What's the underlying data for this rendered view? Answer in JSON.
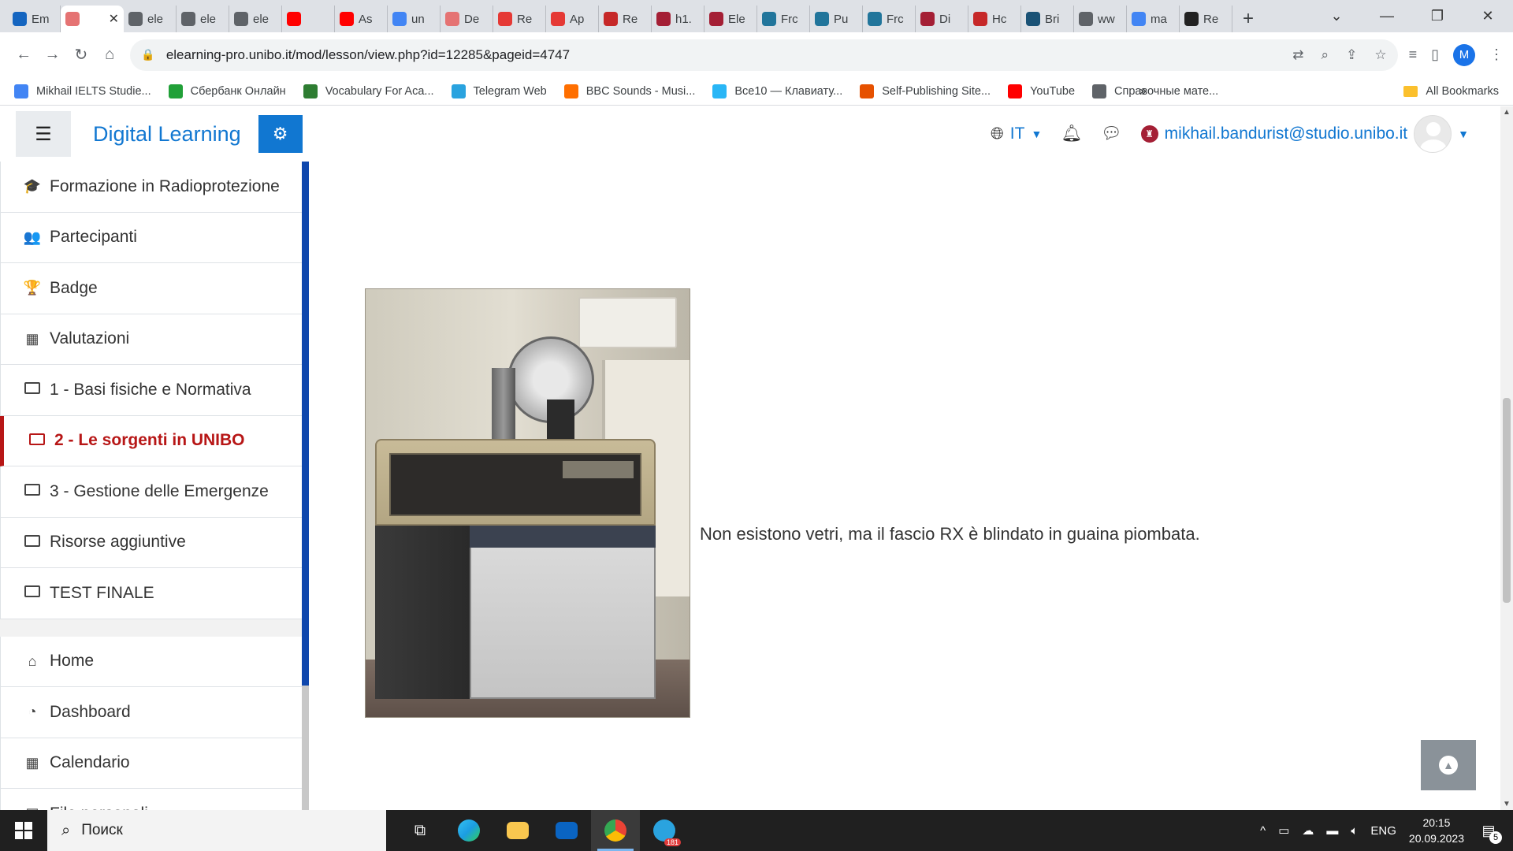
{
  "browser": {
    "tabs": [
      {
        "label": "Em",
        "color": "#1565c0"
      },
      {
        "label": "",
        "color": "#e57373",
        "active": true
      },
      {
        "label": "ele",
        "color": "#5f6368"
      },
      {
        "label": "ele",
        "color": "#5f6368"
      },
      {
        "label": "ele",
        "color": "#5f6368"
      },
      {
        "label": "",
        "color": "#ff0000"
      },
      {
        "label": "As",
        "color": "#ff0000"
      },
      {
        "label": "un",
        "color": "#4285f4"
      },
      {
        "label": "De",
        "color": "#e57373"
      },
      {
        "label": "Re",
        "color": "#e53935"
      },
      {
        "label": "Ap",
        "color": "#e53935"
      },
      {
        "label": "Re",
        "color": "#c62828"
      },
      {
        "label": "h1.",
        "color": "#a41f35"
      },
      {
        "label": "Ele",
        "color": "#a41f35"
      },
      {
        "label": "Frc",
        "color": "#21759b"
      },
      {
        "label": "Pu",
        "color": "#21759b"
      },
      {
        "label": "Frc",
        "color": "#21759b"
      },
      {
        "label": "Di",
        "color": "#a41f35"
      },
      {
        "label": "Hc",
        "color": "#c62828"
      },
      {
        "label": "Bri",
        "color": "#1a5276"
      },
      {
        "label": "ww",
        "color": "#5f6368"
      },
      {
        "label": "ma",
        "color": "#4285f4"
      },
      {
        "label": "Re",
        "color": "#222222"
      }
    ],
    "new_tab": "+",
    "url": "elearning-pro.unibo.it/mod/lesson/view.php?id=12285&pageid=4747",
    "profile_initial": "M",
    "bookmarks": [
      {
        "label": "Mikhail IELTS Studie...",
        "color": "#4285f4"
      },
      {
        "label": "Сбербанк Онлайн",
        "color": "#21a038"
      },
      {
        "label": "Vocabulary For Aca...",
        "color": "#2e7d32"
      },
      {
        "label": "Telegram Web",
        "color": "#2aa3df"
      },
      {
        "label": "BBC Sounds - Musi...",
        "color": "#ff6f00"
      },
      {
        "label": "Все10 — Клавиату...",
        "color": "#29b6f6"
      },
      {
        "label": "Self-Publishing Site...",
        "color": "#e65100"
      },
      {
        "label": "YouTube",
        "color": "#ff0000"
      },
      {
        "label": "Справочные мате...",
        "color": "#5f6368"
      }
    ],
    "bookmarks_more": "»",
    "all_bookmarks": "All Bookmarks"
  },
  "header": {
    "brand": "Digital Learning",
    "language": "IT",
    "user_email": "mikhail.bandurist@studio.unibo.it"
  },
  "sidebar": {
    "items": [
      {
        "label": "Formazione in Radioprotezione",
        "icon": "graduation-cap-icon",
        "glyph": "🎓"
      },
      {
        "label": "Partecipanti",
        "icon": "users-icon",
        "glyph": "👥"
      },
      {
        "label": "Badge",
        "icon": "trophy-icon",
        "glyph": "🏆"
      },
      {
        "label": "Valutazioni",
        "icon": "table-icon",
        "glyph": "▦"
      },
      {
        "label": "1 - Basi fisiche e Normativa",
        "icon": "folder-icon"
      },
      {
        "label": "2 - Le sorgenti in UNIBO",
        "icon": "folder-icon",
        "active": true
      },
      {
        "label": "3 - Gestione delle Emergenze",
        "icon": "folder-icon"
      },
      {
        "label": "Risorse aggiuntive",
        "icon": "folder-icon"
      },
      {
        "label": "TEST FINALE",
        "icon": "folder-icon"
      }
    ],
    "items2": [
      {
        "label": "Home",
        "icon": "home-icon",
        "glyph": "⌂"
      },
      {
        "label": "Dashboard",
        "icon": "dashboard-icon",
        "glyph": "◔"
      },
      {
        "label": "Calendario",
        "icon": "calendar-icon",
        "glyph": "▦"
      },
      {
        "label": "File personali",
        "icon": "file-icon",
        "glyph": "▤"
      }
    ]
  },
  "content": {
    "caption": "Non esistono vetri, ma il fascio RX è blindato in guaina piombata."
  },
  "taskbar": {
    "search_placeholder": "Поиск",
    "telegram_badge": "181",
    "language": "ENG",
    "time": "20:15",
    "date": "20.09.2023",
    "notifications": "5"
  }
}
